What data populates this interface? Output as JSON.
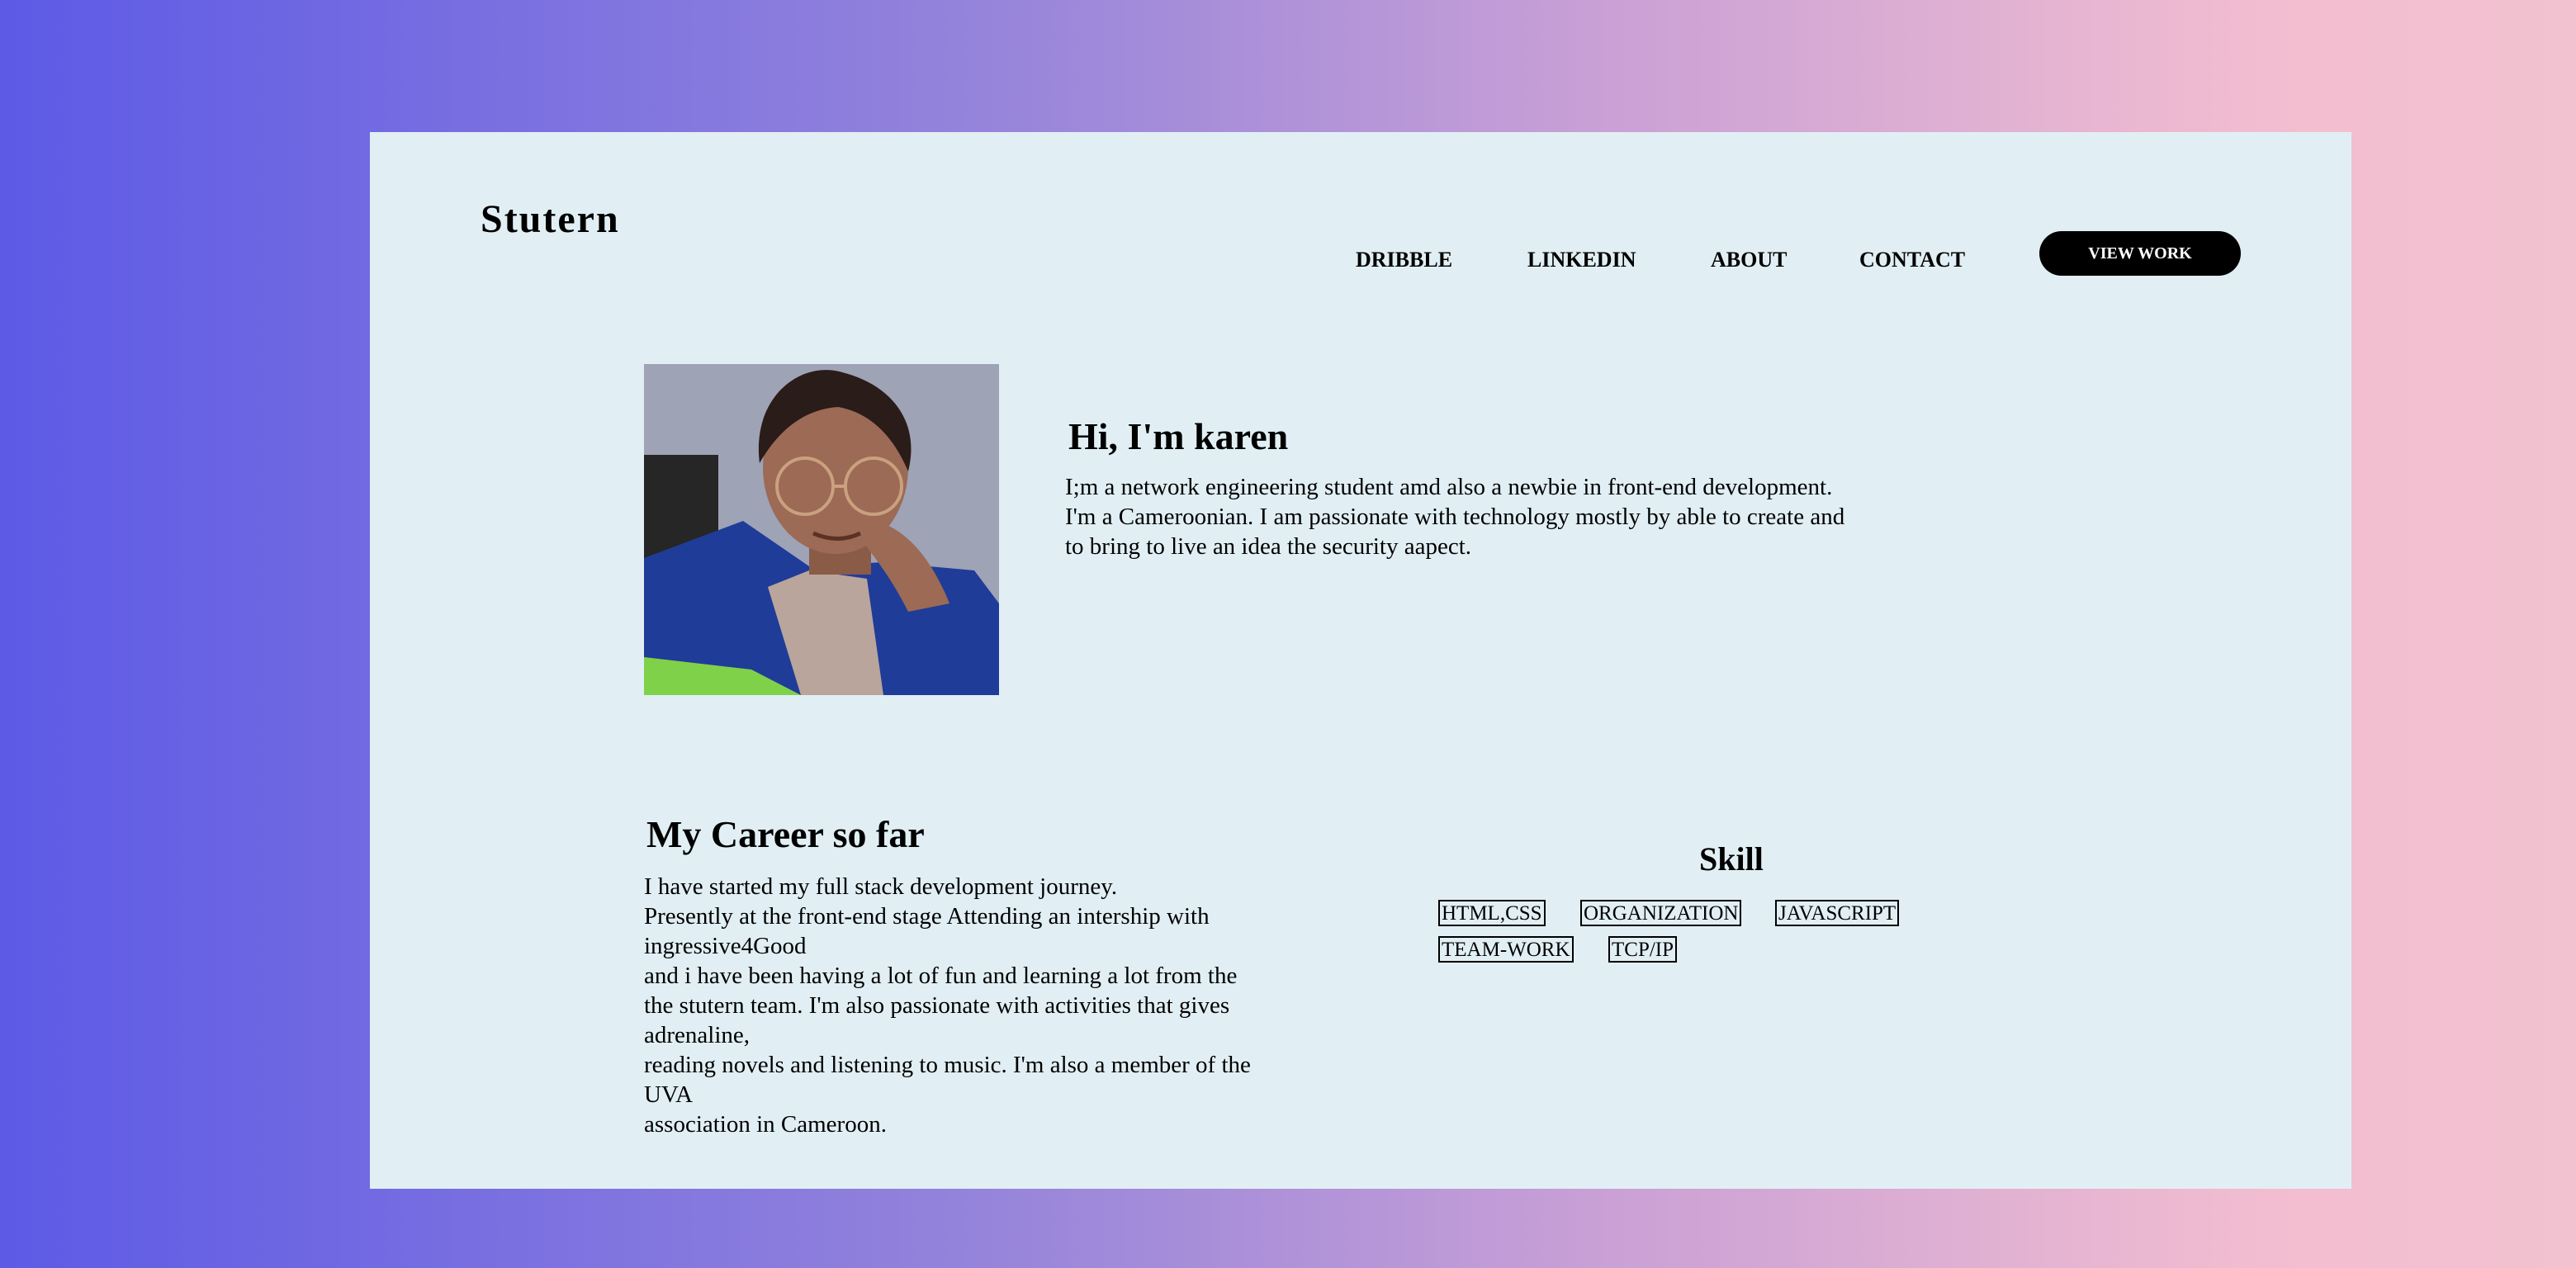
{
  "brand": {
    "logo": "Stutern"
  },
  "nav": {
    "items": [
      {
        "label": "DRIBBLE"
      },
      {
        "label": "LINKEDIN"
      },
      {
        "label": "ABOUT"
      },
      {
        "label": "CONTACT"
      }
    ],
    "cta_label": "VIEW WORK"
  },
  "hero": {
    "title": "Hi, I'm karen",
    "lines": [
      "I;m a network engineering student amd also a newbie in front-end development.",
      "I'm a Cameroonian. I am passionate with technology mostly by able to create and",
      "to bring to live an idea the security aapect."
    ]
  },
  "career": {
    "title": "My Career so far",
    "lines": [
      "I have started my full stack development journey.",
      "Presently at the front-end stage Attending an intership with",
      "ingressive4Good",
      "and i have been having a lot of fun and learning a lot from the",
      "the stutern team. I'm also passionate with activities that gives",
      "adrenaline,",
      "reading novels and listening to music. I'm also a member of the",
      "UVA",
      "association in Cameroon."
    ]
  },
  "skills": {
    "title": "Skill",
    "tags": [
      "HTML,CSS",
      "ORGANIZATION",
      "JAVASCRIPT",
      "TEAM-WORK",
      "TCP/IP"
    ]
  },
  "colors": {
    "card_background": "#e1eff4",
    "cta_background": "#000000",
    "cta_text": "#ffffff",
    "gradient_start": "#5d5ae6",
    "gradient_end": "#f2c2d0"
  }
}
